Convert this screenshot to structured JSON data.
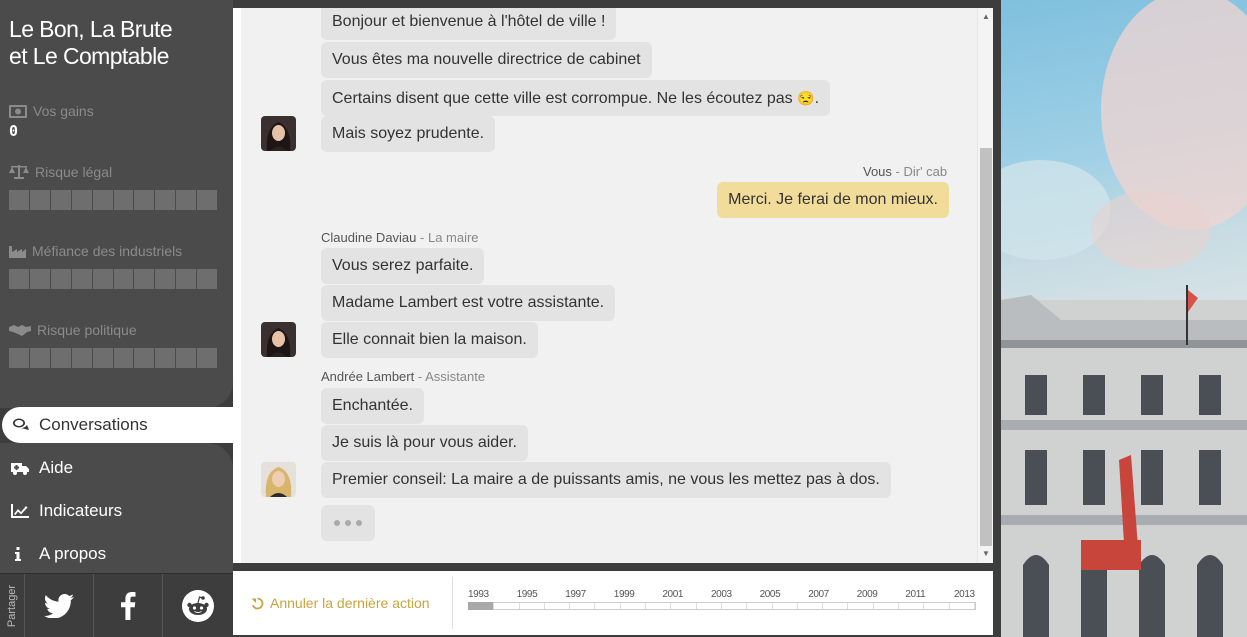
{
  "sidebar": {
    "title_line1": "Le Bon, La Brute",
    "title_line2": "et Le Comptable",
    "gains_label": "Vos gains",
    "gains_value": "0",
    "legal_label": "Risque légal",
    "industry_label": "Méfiance des industriels",
    "political_label": "Risque politique",
    "bar_segments": 10,
    "legal_level": 0,
    "industry_level": 0,
    "political_level": 0,
    "nav": [
      {
        "label": "Conversations",
        "icon": "chat-bubbles-icon",
        "active": true
      },
      {
        "label": "Aide",
        "icon": "ambulance-icon"
      },
      {
        "label": "Indicateurs",
        "icon": "line-chart-icon"
      },
      {
        "label": "A propos",
        "icon": "info-icon"
      }
    ],
    "share_label": "Partager",
    "share_buttons": [
      "twitter-icon",
      "facebook-icon",
      "reddit-icon"
    ]
  },
  "chat": {
    "messages": [
      {
        "text": "Bonjour et bienvenue à l'hôtel de ville !"
      },
      {
        "text": "Vous êtes ma nouvelle directrice de cabinet"
      },
      {
        "text_before": "Certains disent que cette ville est corrompue. Ne les écoutez pas ",
        "emoji": "😒",
        "text_after": "."
      },
      {
        "text": "Mais soyez prudente."
      },
      {
        "text": "Merci. Je ferai de mon mieux."
      },
      {
        "text": "Vous serez parfaite."
      },
      {
        "text": "Madame Lambert est votre assistante."
      },
      {
        "text": "Elle connait bien la maison."
      },
      {
        "text": "Enchantée."
      },
      {
        "text": "Je suis là pour vous aider."
      },
      {
        "text": "Premier conseil: La maire a de puissants amis, ne vous les mettez pas à dos."
      }
    ],
    "you": {
      "name": "Vous",
      "role": " - Dir' cab"
    },
    "mayor": {
      "name": "Claudine Daviau",
      "role": " - La maire"
    },
    "assistant": {
      "name": "Andrée Lambert",
      "role": " - Assistante"
    }
  },
  "bottom": {
    "undo_label": "Annuler la dernière action",
    "years": [
      "1993",
      "1995",
      "1997",
      "1999",
      "2001",
      "2003",
      "2005",
      "2007",
      "2009",
      "2011",
      "2013"
    ],
    "timeline_progress": 0.05
  },
  "colors": {
    "accent_gold": "#c9a43c",
    "my_bubble": "#f1dc9a",
    "other_bubble": "#e3e3e3"
  }
}
